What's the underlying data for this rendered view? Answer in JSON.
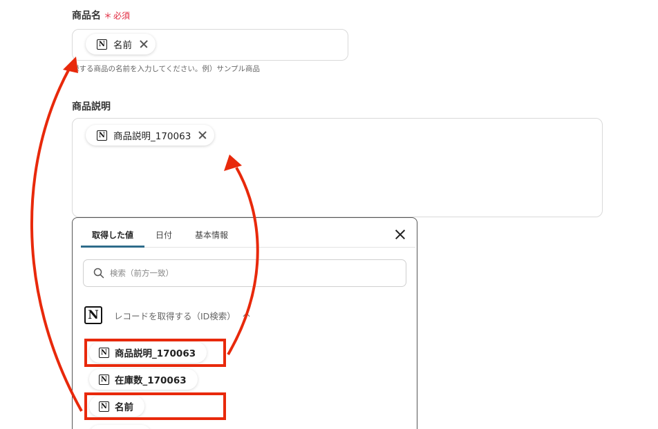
{
  "product_name": {
    "label": "商品名",
    "required_mark": "＊",
    "required_text": "必須",
    "chip_label": "名前",
    "hint": "録する商品の名前を入力してください。例）サンプル商品"
  },
  "product_description": {
    "label": "商品説明",
    "chip_label": "商品説明_170063"
  },
  "picker": {
    "tabs": [
      {
        "label": "取得した値"
      },
      {
        "label": "日付"
      },
      {
        "label": "基本情報"
      }
    ],
    "search_placeholder": "検索（前方一致）",
    "group_title": "レコードを取得する（ID検索）",
    "items": [
      {
        "label": "商品説明_170063"
      },
      {
        "label": "在庫数_170063"
      },
      {
        "label": "名前"
      }
    ]
  },
  "icons": {
    "notion": "N",
    "search": "search-icon",
    "close": "close-icon"
  },
  "colors": {
    "highlight": "#e8290b",
    "required": "#e0243a",
    "tab_accent": "#2d6b8a"
  }
}
